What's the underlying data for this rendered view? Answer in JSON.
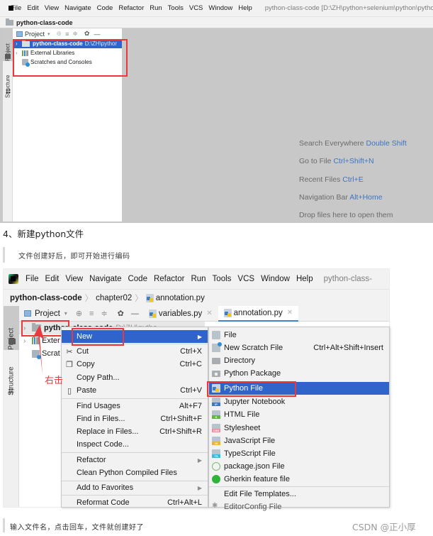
{
  "shot1": {
    "menu": [
      "File",
      "Edit",
      "View",
      "Navigate",
      "Code",
      "Refactor",
      "Run",
      "Tools",
      "VCS",
      "Window",
      "Help"
    ],
    "window_title": "python-class-code [D:\\ZH\\python+selenium\\python\\python-class-",
    "breadcrumb": "python-class-code",
    "side_tabs": {
      "project": "Project",
      "structure": "Structure"
    },
    "panel_toolbar": {
      "label": "Project",
      "dropdown": "▾",
      "locate": "⊕",
      "expand": "≡",
      "collapse": "≑",
      "settings": "✿",
      "hide": "—"
    },
    "tree": [
      {
        "label": "python-class-code",
        "path": "D:\\ZH\\pythor",
        "selected": true
      },
      {
        "label": "External Libraries"
      },
      {
        "label": "Scratches and Consoles"
      }
    ],
    "tips": [
      {
        "text": "Search Everywhere",
        "key": "Double Shift"
      },
      {
        "text": "Go to File",
        "key": "Ctrl+Shift+N"
      },
      {
        "text": "Recent Files",
        "key": "Ctrl+E"
      },
      {
        "text": "Navigation Bar",
        "key": "Alt+Home"
      },
      {
        "text": "Drop files here to open them",
        "key": ""
      }
    ]
  },
  "article": {
    "heading": "4、新建python文件",
    "quote1": "文件创建好后，即可开始进行编码",
    "quote2": "输入文件名，点击回车，文件就创建好了",
    "watermark": "CSDN @正小厚"
  },
  "shot2": {
    "menu": [
      "File",
      "Edit",
      "View",
      "Navigate",
      "Code",
      "Refactor",
      "Run",
      "Tools",
      "VCS",
      "Window",
      "Help"
    ],
    "window_title": "python-class-",
    "breadcrumb": [
      "python-class-code",
      "chapter02",
      "annotation.py"
    ],
    "side_tabs": {
      "project": "Project",
      "structure": "Structure"
    },
    "panel_label": "Project",
    "editor_tabs": [
      {
        "label": "variables.py",
        "active": false
      },
      {
        "label": "annotation.py",
        "active": true
      }
    ],
    "tree": [
      {
        "label": "python-class-code",
        "path": "D:\\ZH\\pytho"
      },
      {
        "label": "Exter"
      },
      {
        "label": "Scrat"
      }
    ],
    "annotation": "右击",
    "context_menu": [
      {
        "label": "New",
        "shortcut": "",
        "submenu": true,
        "selected": true,
        "icon": ""
      },
      {
        "label": "Cut",
        "shortcut": "Ctrl+X",
        "icon": "scissors-icon"
      },
      {
        "label": "Copy",
        "shortcut": "Ctrl+C",
        "icon": "copy-icon"
      },
      {
        "label": "Copy Path...",
        "shortcut": ""
      },
      {
        "label": "Paste",
        "shortcut": "Ctrl+V",
        "icon": "paste-icon"
      },
      {
        "label": "Find Usages",
        "shortcut": "Alt+F7"
      },
      {
        "label": "Find in Files...",
        "shortcut": "Ctrl+Shift+F"
      },
      {
        "label": "Replace in Files...",
        "shortcut": "Ctrl+Shift+R"
      },
      {
        "label": "Inspect Code...",
        "shortcut": ""
      },
      {
        "label": "Refactor",
        "shortcut": "",
        "submenu": true
      },
      {
        "label": "Clean Python Compiled Files",
        "shortcut": ""
      },
      {
        "label": "Add to Favorites",
        "shortcut": "",
        "submenu": true
      },
      {
        "label": "Reformat Code",
        "shortcut": "Ctrl+Alt+L"
      }
    ],
    "new_submenu": [
      {
        "label": "File",
        "shortcut": ""
      },
      {
        "label": "New Scratch File",
        "shortcut": "Ctrl+Alt+Shift+Insert"
      },
      {
        "label": "Directory",
        "shortcut": ""
      },
      {
        "label": "Python Package",
        "shortcut": ""
      },
      {
        "label": "Python File",
        "shortcut": "",
        "selected": true
      },
      {
        "label": "Jupyter Notebook",
        "shortcut": ""
      },
      {
        "label": "HTML File",
        "shortcut": ""
      },
      {
        "label": "Stylesheet",
        "shortcut": ""
      },
      {
        "label": "JavaScript File",
        "shortcut": ""
      },
      {
        "label": "TypeScript File",
        "shortcut": ""
      },
      {
        "label": "package.json File",
        "shortcut": ""
      },
      {
        "label": "Gherkin feature file",
        "shortcut": ""
      },
      {
        "label": "Edit File Templates...",
        "shortcut": ""
      },
      {
        "label": "EditorConfig File",
        "shortcut": ""
      }
    ],
    "colors": {
      "selection": "#2f65ca",
      "highlight_box": "#e8393e"
    }
  }
}
